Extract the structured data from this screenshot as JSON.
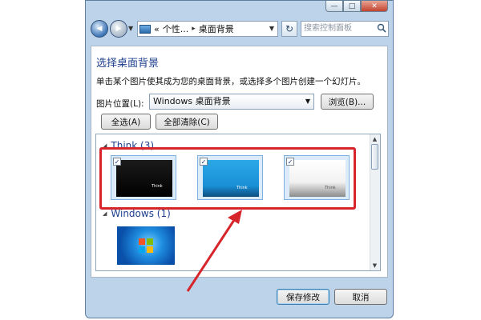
{
  "titlebar": {
    "minimize": "—",
    "maximize": "□",
    "close": "✕"
  },
  "navbar": {
    "back_glyph": "◀",
    "forward_glyph": "▶",
    "dropdown_glyph": "▼",
    "breadcrumb": [
      "«",
      "个性...",
      "▸",
      "桌面背景"
    ],
    "refresh_glyph": "↻",
    "search_placeholder": "搜索控制面板"
  },
  "main": {
    "title": "选择桌面背景",
    "description": "单击某个图片使其成为您的桌面背景，或选择多个图片创建一个幻灯片。",
    "location_label": "图片位置(L):",
    "location_value": "Windows 桌面背景",
    "browse_label": "浏览(B)...",
    "select_all_label": "全选(A)",
    "clear_all_label": "全部清除(C)"
  },
  "gallery": {
    "groups": [
      {
        "name": "Think (3)",
        "items": [
          {
            "label": "Think",
            "checked": true,
            "style": "black"
          },
          {
            "label": "Think",
            "checked": true,
            "style": "blue"
          },
          {
            "label": "Think",
            "checked": true,
            "style": "white"
          }
        ]
      },
      {
        "name": "Windows (1)",
        "items": [
          {
            "label": "",
            "checked": false,
            "style": "windows7"
          }
        ]
      }
    ],
    "check_glyph": "✓"
  },
  "footer": {
    "save_label": "保存修改",
    "cancel_label": "取消"
  },
  "colors": {
    "annotation": "#d7262b",
    "heading": "#1e3f8f"
  }
}
